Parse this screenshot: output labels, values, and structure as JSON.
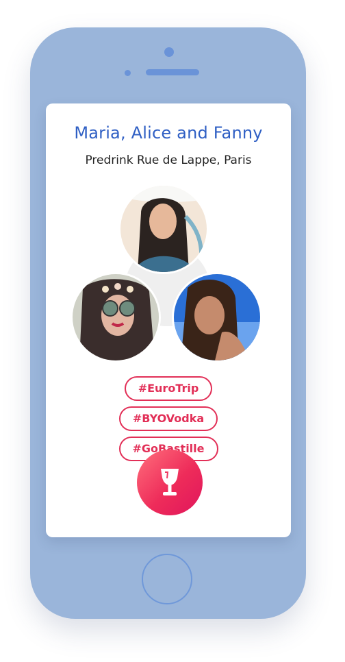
{
  "card": {
    "title": "Maria, Alice and Fanny",
    "subtitle": "Predrink Rue de Lappe, Paris"
  },
  "tags": [
    "#EuroTrip",
    "#BYOVodka",
    "#GoBastille"
  ],
  "colors": {
    "phone_body": "#9ab5da",
    "title": "#2f5fc4",
    "accent": "#e22f57"
  },
  "icons": {
    "action": "wine-glass-icon"
  }
}
